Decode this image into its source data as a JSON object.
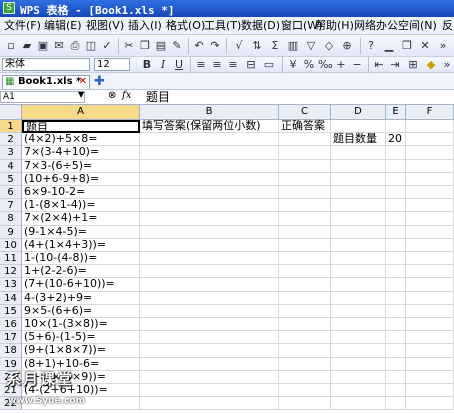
{
  "window": {
    "title": "WPS 表格 - [Book1.xls *]",
    "app_icon": "S"
  },
  "menu": [
    "文件(F)",
    "编辑(E)",
    "视图(V)",
    "插入(I)",
    "格式(O)",
    "工具(T)",
    "数据(D)",
    "窗口(W)",
    "帮助(H)",
    "网络办公空间(N)"
  ],
  "menu_end": "反",
  "font": {
    "name": "宋体",
    "size": "12"
  },
  "tab": {
    "label": "Book1.xls *"
  },
  "formula": {
    "cell_ref": "A1",
    "fx": "fx",
    "content": "题目"
  },
  "columns": [
    "A",
    "B",
    "C",
    "D",
    "E",
    "F"
  ],
  "rows": [
    {
      "n": "1",
      "a": "题目",
      "b": "填写答案(保留两位小数)",
      "c": "正确答案",
      "d": "",
      "e": ""
    },
    {
      "n": "2",
      "a": "(4×2)+5×8=",
      "b": "",
      "c": "",
      "d": "题目数量",
      "e": "20"
    },
    {
      "n": "3",
      "a": "7×(3-4+10)=",
      "b": "",
      "c": "",
      "d": "",
      "e": ""
    },
    {
      "n": "4",
      "a": "7×3-(6÷5)=",
      "b": "",
      "c": "",
      "d": "",
      "e": ""
    },
    {
      "n": "5",
      "a": "(10+6-9+8)=",
      "b": "",
      "c": "",
      "d": "",
      "e": ""
    },
    {
      "n": "6",
      "a": "6×9-10-2=",
      "b": "",
      "c": "",
      "d": "",
      "e": ""
    },
    {
      "n": "7",
      "a": "(1-(8×1-4))=",
      "b": "",
      "c": "",
      "d": "",
      "e": ""
    },
    {
      "n": "8",
      "a": "7×(2×4)+1=",
      "b": "",
      "c": "",
      "d": "",
      "e": ""
    },
    {
      "n": "9",
      "a": "(9-1×4-5)=",
      "b": "",
      "c": "",
      "d": "",
      "e": ""
    },
    {
      "n": "10",
      "a": "(4+(1×4+3))=",
      "b": "",
      "c": "",
      "d": "",
      "e": ""
    },
    {
      "n": "11",
      "a": "1-(10-(4-8))=",
      "b": "",
      "c": "",
      "d": "",
      "e": ""
    },
    {
      "n": "12",
      "a": "1+(2-2-6)=",
      "b": "",
      "c": "",
      "d": "",
      "e": ""
    },
    {
      "n": "13",
      "a": "(7+(10-6+10))=",
      "b": "",
      "c": "",
      "d": "",
      "e": ""
    },
    {
      "n": "14",
      "a": "4-(3+2)+9=",
      "b": "",
      "c": "",
      "d": "",
      "e": ""
    },
    {
      "n": "15",
      "a": "9×5-(6+6)=",
      "b": "",
      "c": "",
      "d": "",
      "e": ""
    },
    {
      "n": "16",
      "a": "10×(1-(3×8))=",
      "b": "",
      "c": "",
      "d": "",
      "e": ""
    },
    {
      "n": "17",
      "a": "(5+6)-(1-5)=",
      "b": "",
      "c": "",
      "d": "",
      "e": ""
    },
    {
      "n": "18",
      "a": "(9+(1×8×7))=",
      "b": "",
      "c": "",
      "d": "",
      "e": ""
    },
    {
      "n": "19",
      "a": "(8+1)+10-6=",
      "b": "",
      "c": "",
      "d": "",
      "e": ""
    },
    {
      "n": "20",
      "a": "1+(6×(3×9))=",
      "b": "",
      "c": "",
      "d": "",
      "e": ""
    },
    {
      "n": "21",
      "a": "(4-(2+6+10))=",
      "b": "",
      "c": "",
      "d": "",
      "e": ""
    },
    {
      "n": "22",
      "a": "",
      "b": "",
      "c": "",
      "d": "",
      "e": ""
    }
  ],
  "watermark": {
    "text": "系月课堂",
    "url": "www.Syue.com"
  },
  "colors": {
    "titlebar": "#1f55c8",
    "header_selected": "#f7d98b",
    "grid_line": "#d9d9d9"
  }
}
